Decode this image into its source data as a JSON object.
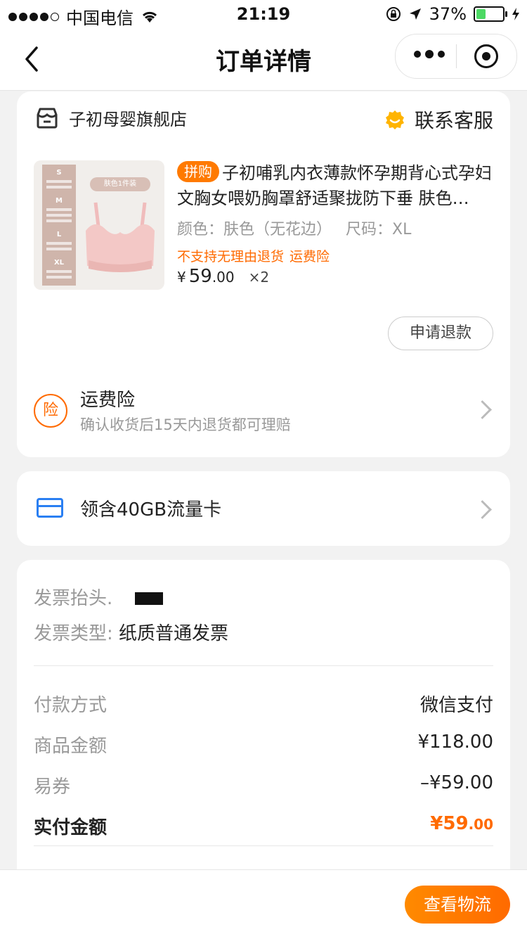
{
  "status_bar": {
    "carrier": "中国电信",
    "time": "21:19",
    "battery": "37%"
  },
  "nav": {
    "title": "订单详情"
  },
  "store": {
    "name": "子初母婴旗舰店",
    "service_label": "联系客服"
  },
  "product": {
    "badge": "拼购",
    "title": "子初哺乳内衣薄款怀孕期背心式孕妇文胸女喂奶胸罩舒适聚拢防下垂 肤色…",
    "color": "颜色：肤色（无花边）",
    "size": "尺码：XL",
    "notice": "不支持无理由退货",
    "insurance_tag": "运费险",
    "currency": "¥",
    "price_int": "59",
    "price_dec": ".00",
    "quantity": "×2",
    "image": {
      "sizes": [
        "S",
        "M",
        "L",
        "XL"
      ],
      "tag": "肤色1件装"
    }
  },
  "refund_button": "申请退款",
  "insurance": {
    "icon_char": "险",
    "title": "运费险",
    "subtitle": "确认收货后15天内退货都可理赔"
  },
  "data_card": {
    "text": "领含40GB流量卡"
  },
  "invoice": {
    "title_label": "发票抬头.",
    "type_label": "发票类型:",
    "type_value": "纸质普通发票"
  },
  "payment": {
    "method_label": "付款方式",
    "method_value": "微信支付",
    "goods_label": "商品金额",
    "goods_value": "¥118.00",
    "coupon_label": "易券",
    "coupon_value": "–¥59.00",
    "paid_label": "实付金额",
    "paid_int": "¥59",
    "paid_dec": ".00"
  },
  "bottom": {
    "logistics_button": "查看物流"
  },
  "colors": {
    "accent": "#ff6a00",
    "blue": "#2a7ff2",
    "background": "#f2f2f2"
  }
}
